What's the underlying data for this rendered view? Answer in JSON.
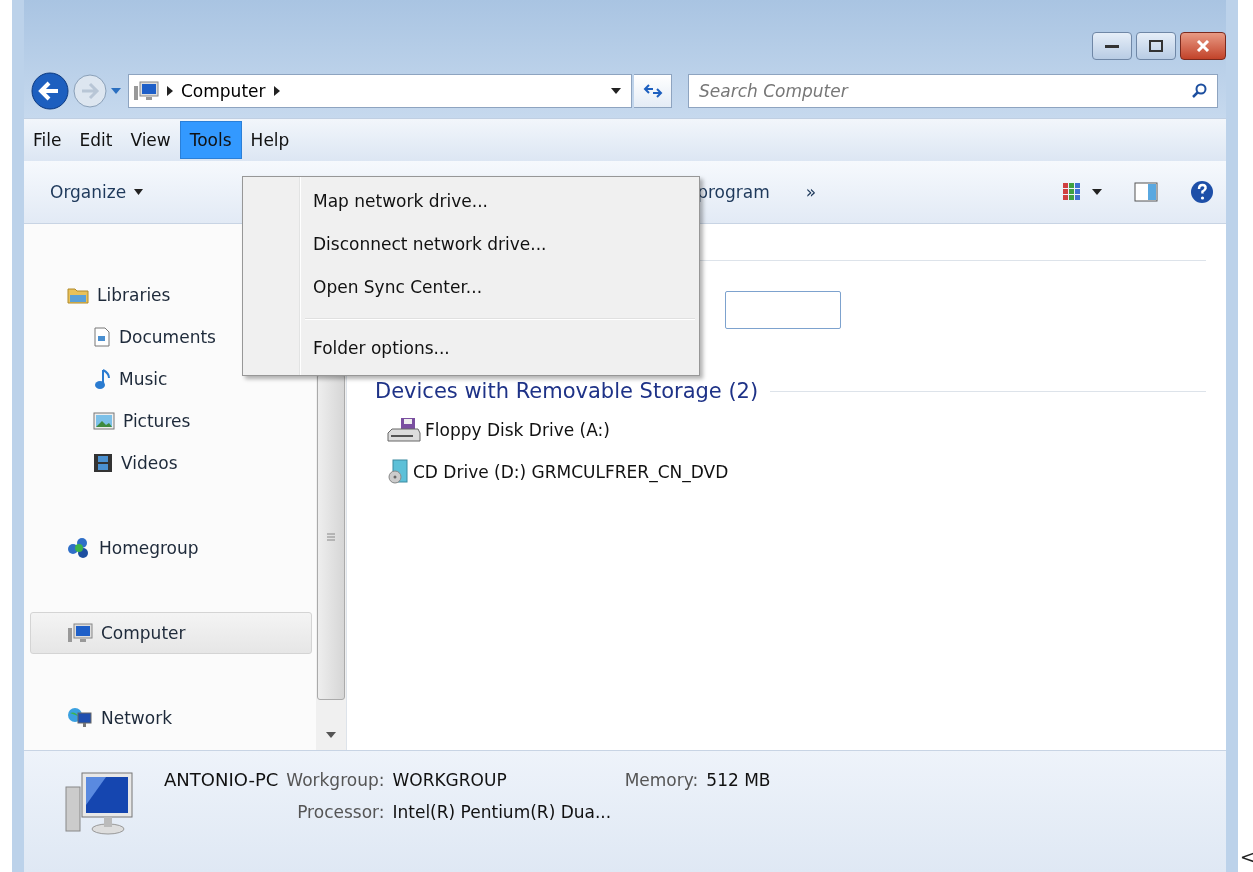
{
  "address_bar": {
    "segments": [
      "Computer"
    ]
  },
  "search": {
    "placeholder": "Search Computer"
  },
  "menu_bar": [
    {
      "label": "File",
      "selected": false
    },
    {
      "label": "Edit",
      "selected": false
    },
    {
      "label": "View",
      "selected": false
    },
    {
      "label": "Tools",
      "selected": true
    },
    {
      "label": "Help",
      "selected": false
    }
  ],
  "toolbar": {
    "items": [
      {
        "label": "Organize",
        "kind": "dropdown"
      },
      {
        "label": "program",
        "kind": "command"
      },
      {
        "label": "»",
        "kind": "more"
      }
    ]
  },
  "tools_menu": {
    "items": [
      {
        "label": "Map network drive...",
        "kind": "item"
      },
      {
        "label": "Disconnect network drive...",
        "kind": "item"
      },
      {
        "label": "Open Sync Center...",
        "kind": "item"
      },
      {
        "kind": "separator"
      },
      {
        "label": "Folder options...",
        "kind": "item"
      }
    ]
  },
  "navigation": [
    {
      "label": "Libraries",
      "selected": false,
      "children": [
        {
          "label": "Documents",
          "selected": false
        },
        {
          "label": "Music",
          "selected": false
        },
        {
          "label": "Pictures",
          "selected": false
        },
        {
          "label": "Videos",
          "selected": false
        }
      ]
    },
    {
      "label": "Homegroup",
      "selected": false
    },
    {
      "label": "Computer",
      "selected": true
    },
    {
      "label": "Network",
      "selected": false
    }
  ],
  "content": {
    "groups": [
      {
        "title": "Devices with Removable Storage (2)",
        "items": [
          {
            "label": "Floppy Disk Drive (A:)"
          },
          {
            "label": "CD Drive (D:) GRMCULFRER_CN_DVD"
          }
        ]
      }
    ]
  },
  "details": {
    "name": "ANTONIO-PC",
    "fields": [
      {
        "label": "Workgroup:",
        "value": "WORKGROUP"
      },
      {
        "label": "Memory:",
        "value": "512 MB"
      },
      {
        "label": "Processor:",
        "value": "Intel(R) Pentium(R) Dua..."
      }
    ]
  },
  "edge_mark": "<"
}
